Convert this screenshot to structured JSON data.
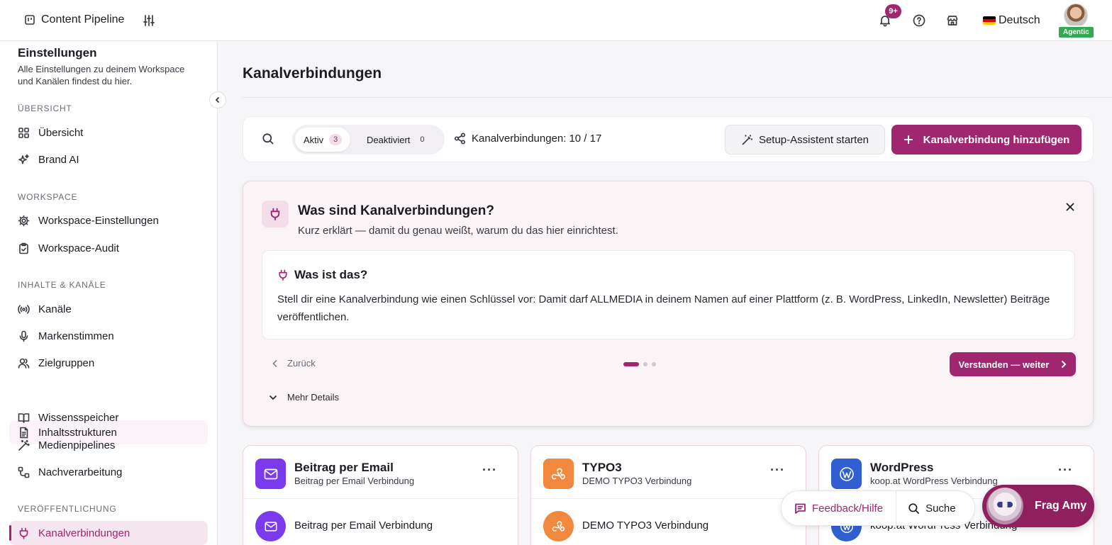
{
  "topbar": {
    "app_name": "Content Pipeline",
    "notifications_badge": "9+",
    "language": "Deutsch",
    "user_badge": "Agentic"
  },
  "sidebar": {
    "title": "Einstellungen",
    "description": "Alle Einstellungen zu deinem Workspace und Kanälen findest du hier.",
    "sections": {
      "overview": "ÜBERSICHT",
      "workspace": "WORKSPACE",
      "content": "INHALTE & KANÄLE",
      "publishing": "VERÖFFENTLICHUNG"
    },
    "items": {
      "uebersicht": "Übersicht",
      "brand_ai": "Brand AI",
      "workspace_settings": "Workspace-Einstellungen",
      "workspace_audit": "Workspace-Audit",
      "kanaele": "Kanäle",
      "markenstimmen": "Markenstimmen",
      "zielgruppen": "Zielgruppen",
      "inhaltsstrukturen": "Inhaltsstrukturen",
      "wissensspeicher": "Wissensspeicher",
      "medienpipelines": "Medienpipelines",
      "nachverarbeitung": "Nachverarbeitung",
      "kanalverbindungen": "Kanalverbindungen"
    }
  },
  "main": {
    "title": "Kanalverbindungen",
    "toolbar": {
      "filter_active_label": "Aktiv",
      "filter_active_count": "3",
      "filter_inactive_label": "Deaktiviert",
      "filter_inactive_count": "0",
      "connections_label": "Kanalverbindungen:",
      "connections_value": "10 / 17",
      "setup_button": "Setup-Assistent starten",
      "add_button": "Kanalverbindung hinzufügen"
    },
    "info": {
      "title": "Was sind Kanalverbindungen?",
      "subtitle": "Kurz erklärt — damit du genau weißt, warum du das hier einrichtest.",
      "step_title": "Was ist das?",
      "step_text": "Stell dir eine Kanalverbindung wie einen Schlüssel vor: Damit darf ALLMEDIA in deinem Namen auf einer Plattform (z. B. WordPress, LinkedIn, Newsletter) Beiträge veröffentlichen.",
      "back_label": "Zurück",
      "next_label": "Verstanden — weiter",
      "more_label": "Mehr Details",
      "current_step": 1,
      "total_steps": 3
    },
    "cards": [
      {
        "name": "Beitrag per Email",
        "subtitle": "Beitrag per Email Verbindung",
        "connection": "Beitrag per Email Verbindung",
        "color": "#7c3aed"
      },
      {
        "name": "TYPO3",
        "subtitle": "DEMO TYPO3 Verbindung",
        "connection": "DEMO TYPO3 Verbindung",
        "color": "#f0883e"
      },
      {
        "name": "WordPress",
        "subtitle": "koop.at WordPress Verbindung",
        "connection": "koop.at WordPress Verbindung",
        "color": "#2f5fd0"
      }
    ]
  },
  "floating": {
    "feedback_label": "Feedback/Hilfe",
    "search_label": "Suche",
    "assistant_label": "Frag Amy"
  },
  "colors": {
    "accent": "#a0266f",
    "success_badge": "#34a853"
  }
}
